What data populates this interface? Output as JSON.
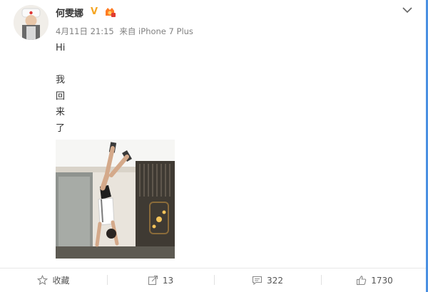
{
  "post": {
    "username": "何雯娜",
    "verified_badge": "V",
    "timestamp": "4月11日 21:15",
    "source": "来自 iPhone 7 Plus",
    "lines": [
      "Hi",
      "",
      "我",
      "回",
      "来",
      "了"
    ]
  },
  "actions": {
    "favorite_label": "收藏",
    "repost_count": "13",
    "comment_count": "322",
    "like_count": "1730"
  },
  "icons": {
    "more": "chevron-down-icon",
    "favorite": "star-icon",
    "repost": "share-icon",
    "comment": "comment-icon",
    "like": "thumbs-up-icon"
  },
  "colors": {
    "accent": "#f5a623",
    "text": "#333333",
    "meta": "#808080",
    "selection": "#4a90e2"
  }
}
